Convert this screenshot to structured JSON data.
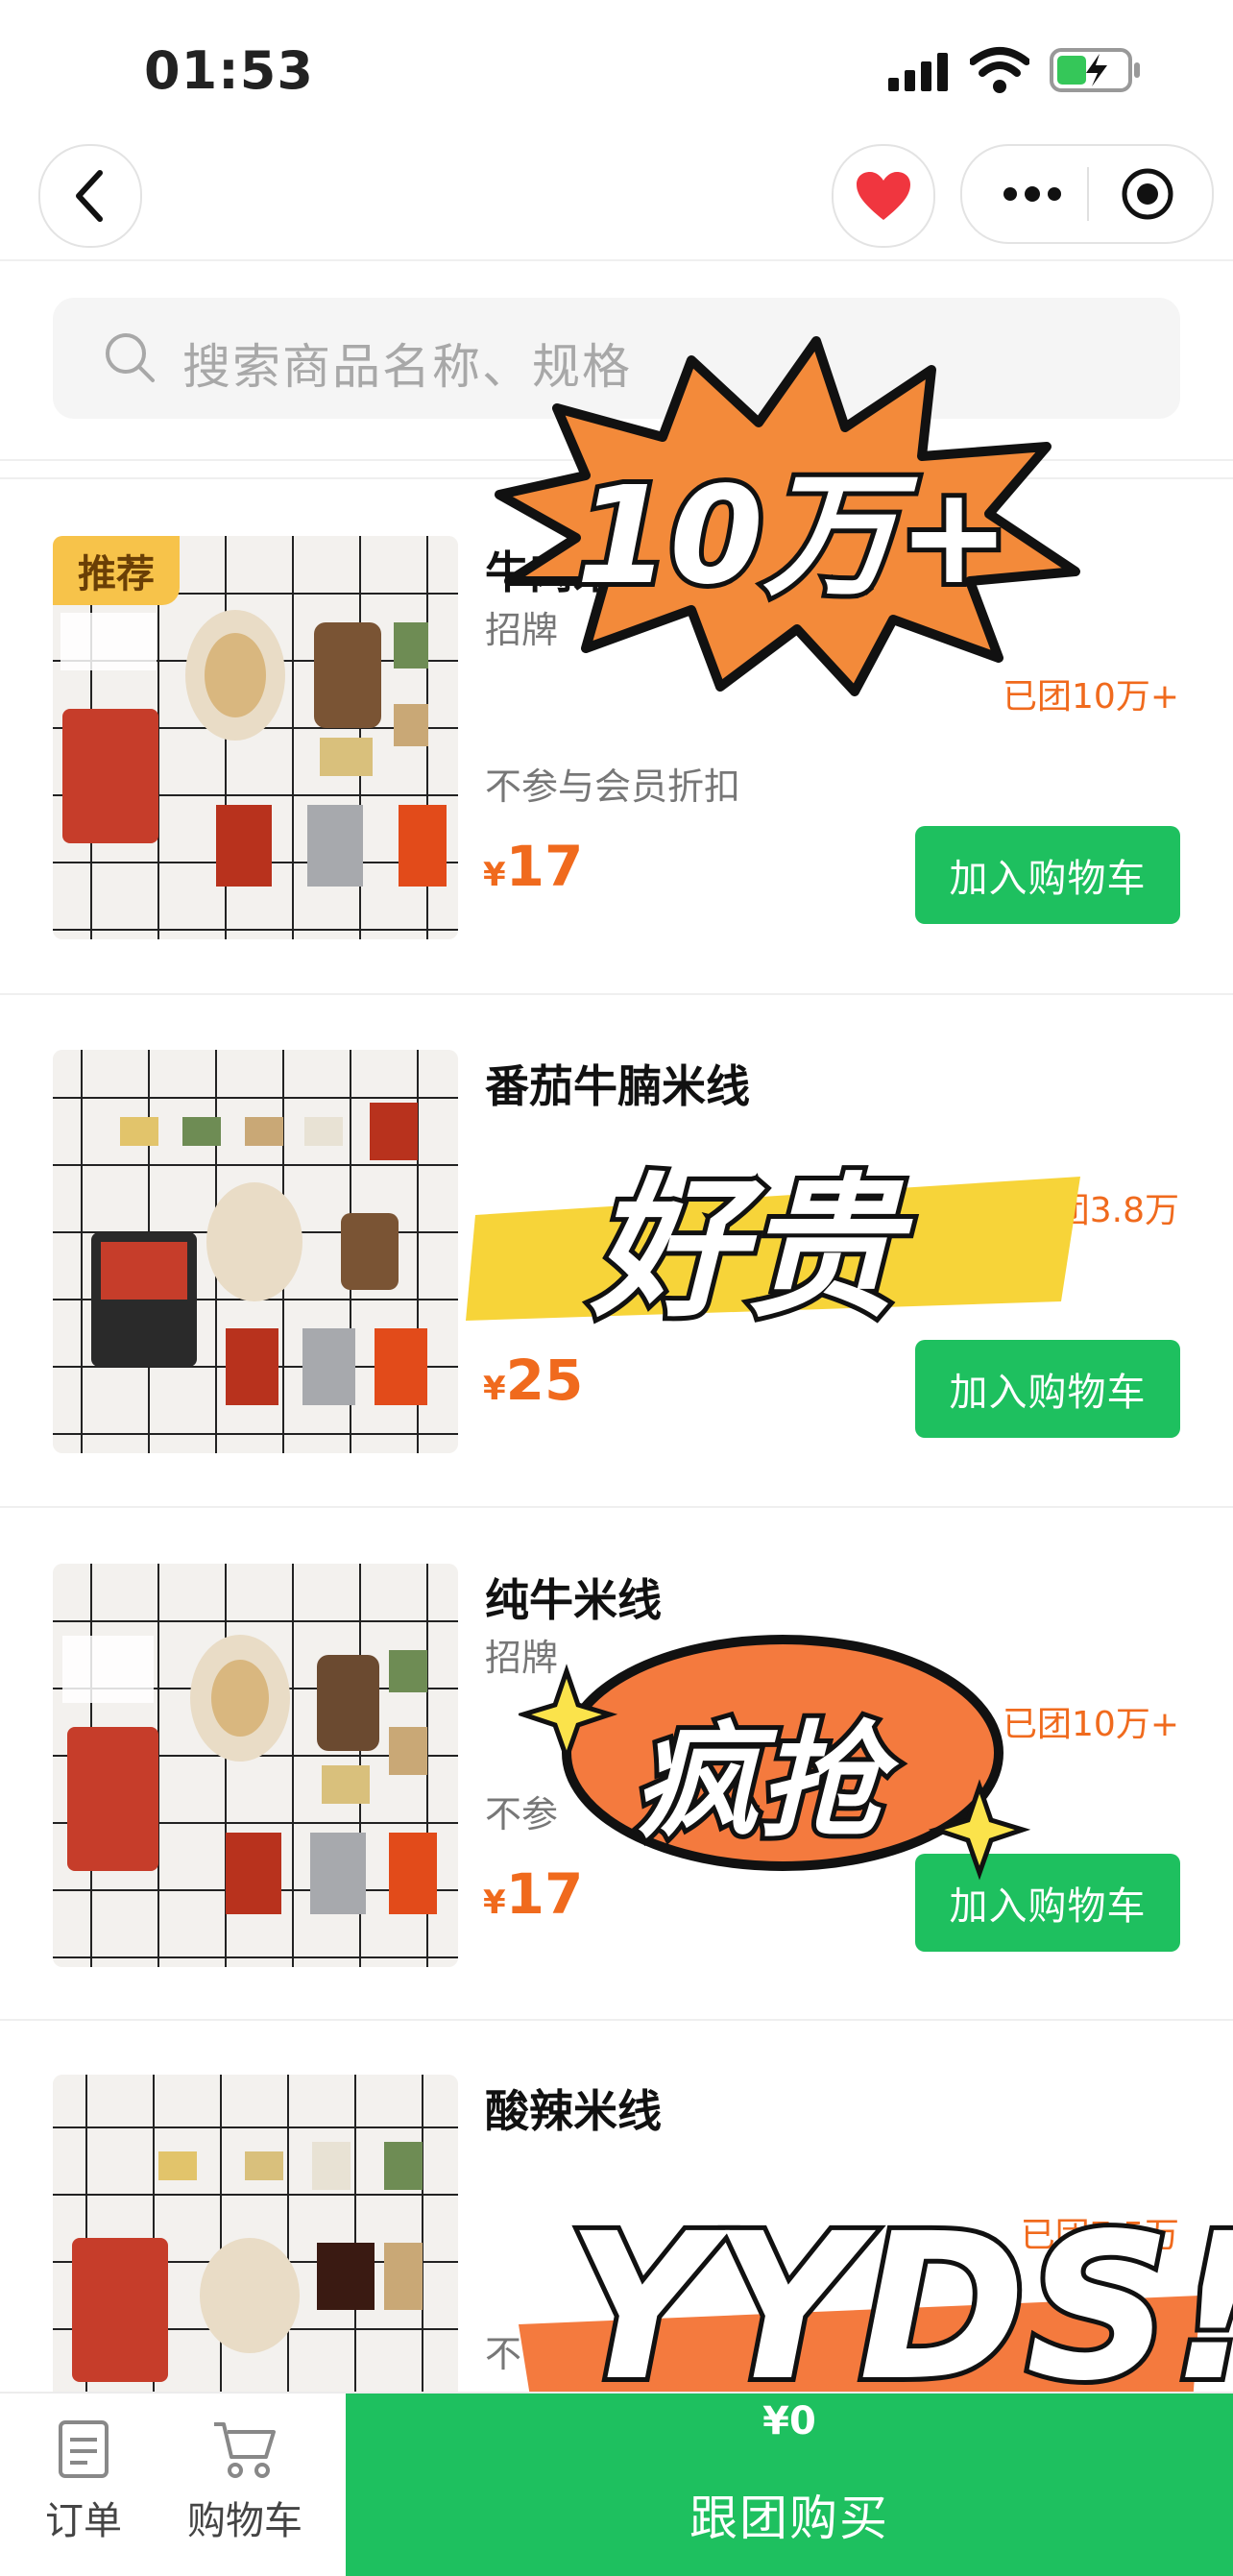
{
  "status_bar": {
    "time": "01:53"
  },
  "nav": {
    "back": "back",
    "favorite": "favorite",
    "more": "more",
    "close": "close-miniprogram"
  },
  "search": {
    "placeholder": "搜索商品名称、规格"
  },
  "products": [
    {
      "badge": "推荐",
      "name": "牛肉米线",
      "desc": "招牌",
      "count": "已团10万+",
      "note": "不参与会员折扣",
      "currency": "¥",
      "price": "17",
      "button": "加入购物车"
    },
    {
      "name": "番茄牛腩米线",
      "count": "已团3.8万",
      "currency": "¥",
      "price": "25",
      "button": "加入购物车"
    },
    {
      "name": "纯牛米线",
      "desc": "招牌",
      "count": "已团10万+",
      "note": "不参",
      "currency": "¥",
      "price": "17",
      "button": "加入购物车"
    },
    {
      "name": "酸辣米线",
      "count": "已团7.5万",
      "note": "不"
    }
  ],
  "stickers": {
    "burst": "10万+",
    "highlight": "好贵",
    "ellipse": "疯抢",
    "bottom": "YYDS!"
  },
  "bottom_bar": {
    "orders_label": "订单",
    "cart_label": "购物车",
    "amount": "¥0",
    "buy_label": "跟团购买"
  }
}
